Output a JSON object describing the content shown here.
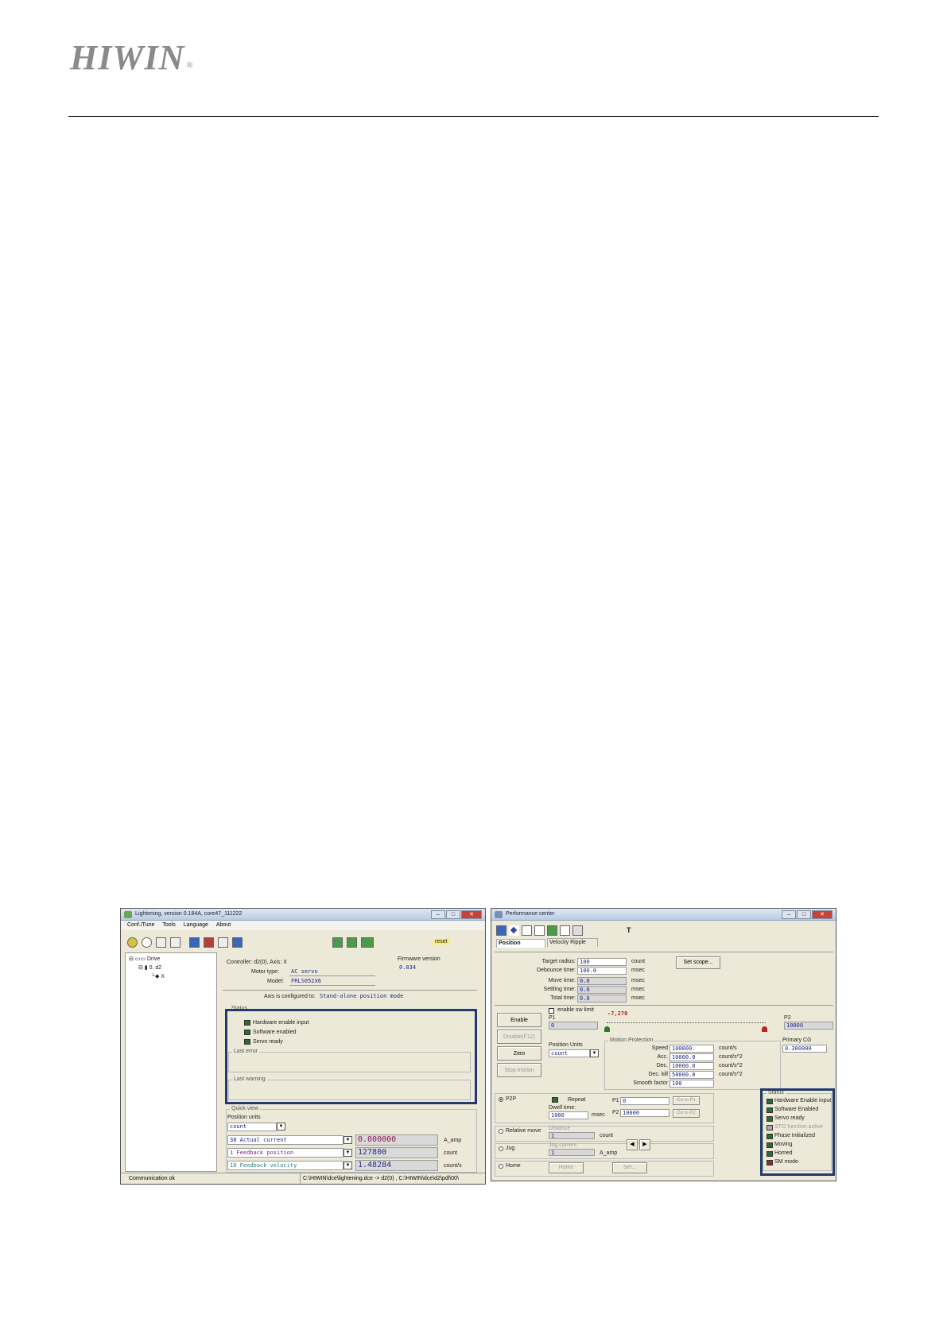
{
  "header": {
    "logo_text": "HIWIN",
    "logo_mark": "®"
  },
  "lightening": {
    "title": "Lightening, version 0.184A, core47_111222",
    "menu": [
      "Conf./Tune",
      "Tools",
      "Language",
      "About"
    ],
    "toolbar_reset": "reset",
    "tree": {
      "root": "Drive",
      "node": "0. d2",
      "leaf": "X"
    },
    "controller_info": "Controller: d2(0), Axis: X",
    "motor_type_label": "Motor type:",
    "motor_type": "AC servo",
    "model_label": "Model:",
    "model": "FRLS052X6",
    "firmware_label": "Firmware version",
    "firmware": "0.034",
    "axis_config_label": "Axis is configured to:",
    "axis_config": "Stand-alone position mode",
    "status_title": "Status",
    "status_items": [
      "Hardware enable input",
      "Software enabled",
      "Servo ready"
    ],
    "last_error_title": "Last error",
    "last_warning_title": "Last warning",
    "quick_view_title": "Quick view",
    "position_units_label": "Position units",
    "position_units": "count",
    "quick_rows": [
      {
        "name": "38 Actual current",
        "value": "0.000000",
        "unit": "A_amp",
        "color": "#8a1a5a"
      },
      {
        "name": "1 Feedback position",
        "value": "127800",
        "unit": "count",
        "color": "#7a2a8a"
      },
      {
        "name": "10 Feedback velocity",
        "value": "1.48284",
        "unit": "count/s",
        "color": "#2a7a7a"
      }
    ],
    "status_bar_left": "Communication ok",
    "status_bar_right": "C:\\HIWIN\\dce\\lightening.dce -> d2(0) , C:\\HIWIN\\dce\\d2\\pdl\\00\\"
  },
  "perf": {
    "title": "Performance center",
    "tabs": [
      "Position",
      "Velocity Ripple"
    ],
    "toolbar_t": "T",
    "target_radius_label": "Target radius:",
    "target_radius": "100",
    "target_radius_unit": "count",
    "debounce_label": "Debounce time:",
    "debounce": "100.0",
    "debounce_unit": "msec",
    "move_time_label": "Move time:",
    "move_time": "0.0",
    "move_time_unit": "msec",
    "settling_label": "Settling time:",
    "settling": "0.0",
    "settling_unit": "msec",
    "total_label": "Total time:",
    "total": "0.0",
    "total_unit": "msec",
    "set_scope": "Set scope...",
    "enable_sw_limit": "enable sw limit",
    "p1_label": "P1",
    "p1_value": "0",
    "p2_label": "P2",
    "p2_value": "10000",
    "slider_value": "-7,270",
    "buttons": [
      "Enable",
      "Disable(F12)",
      "Zero",
      "Stop motion"
    ],
    "position_units_label": "Position Units",
    "position_units": "count",
    "motion_title": "Motion Protection",
    "motion": [
      {
        "label": "Speed",
        "value": "100000.",
        "unit": "count/s"
      },
      {
        "label": "Acc.",
        "value": "10000.0",
        "unit": "count/s^2"
      },
      {
        "label": "Dec.",
        "value": "10000.0",
        "unit": "count/s^2"
      },
      {
        "label": "Dec. kill",
        "value": "50000.0",
        "unit": "count/s^2"
      },
      {
        "label": "Smooth factor",
        "value": "100",
        "unit": ""
      }
    ],
    "primary_cg_label": "Primary CG",
    "primary_cg": "0.300000",
    "modes": [
      "P2P",
      "Relative move",
      "Jog",
      "Home"
    ],
    "repeat_label": "Repeat",
    "dwell_label": "Dwell time:",
    "dwell": "1000",
    "dwell_unit": "msec",
    "p2p_p1_label": "P1",
    "p2p_p1": "0",
    "go_p1": "Go to P1",
    "p2p_p2_label": "P2",
    "p2p_p2": "10000",
    "go_p2": "Go to P2",
    "distance_label": "Distance",
    "distance": "1",
    "distance_unit": "count",
    "jog_current_label": "Jog current",
    "jog_current": "1",
    "jog_current_unit": "A_amp",
    "home_btn": "Home",
    "set_btn": "Set...",
    "status_title": "Status",
    "status_items": [
      {
        "label": "Hardware Enable input",
        "state": "on"
      },
      {
        "label": "Software Enabled",
        "state": "on"
      },
      {
        "label": "Servo ready",
        "state": "on"
      },
      {
        "label": "STO function active",
        "state": "off"
      },
      {
        "label": "Phase Initialized",
        "state": "on"
      },
      {
        "label": "Moving",
        "state": "on"
      },
      {
        "label": "Homed",
        "state": "on"
      },
      {
        "label": "SM mode",
        "state": "red"
      }
    ]
  }
}
